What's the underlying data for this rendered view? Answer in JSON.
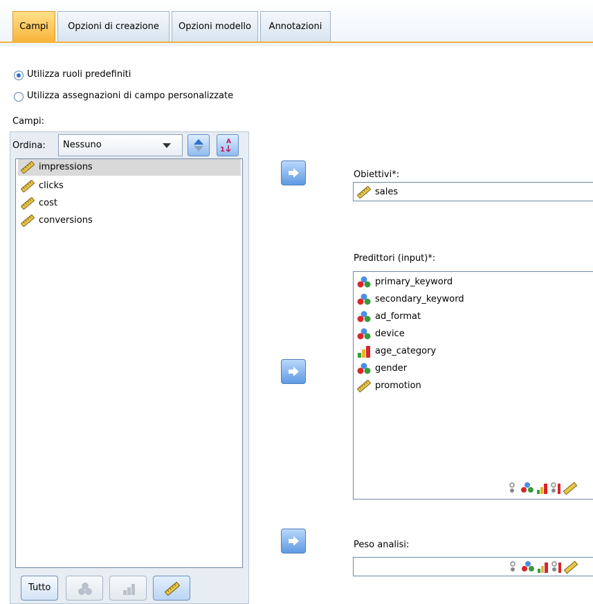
{
  "tabs": [
    {
      "label": "Campi",
      "active": true
    },
    {
      "label": "Opzioni di creazione",
      "active": false
    },
    {
      "label": "Opzioni modello",
      "active": false
    },
    {
      "label": "Annotazioni",
      "active": false
    }
  ],
  "roles": {
    "predefined": {
      "label": "Utilizza ruoli predefiniti",
      "selected": true
    },
    "custom": {
      "label": "Utilizza assegnazioni di campo personalizzate",
      "selected": false
    }
  },
  "fields": {
    "title": "Campi:",
    "sort_label": "Ordina:",
    "sort_value": "Nessuno",
    "items": [
      {
        "label": "impressions",
        "icon": "ruler-icon",
        "selected": true
      },
      {
        "label": "clicks",
        "icon": "ruler-icon",
        "selected": false
      },
      {
        "label": "cost",
        "icon": "ruler-icon",
        "selected": false
      },
      {
        "label": "conversions",
        "icon": "ruler-icon",
        "selected": false
      }
    ],
    "all_button": "Tutto"
  },
  "targets": {
    "label": "Obiettivi*:",
    "items": [
      {
        "label": "sales",
        "icon": "ruler-icon"
      }
    ]
  },
  "predictors": {
    "label": "Predittori (input)*:",
    "items": [
      {
        "label": "primary_keyword",
        "icon": "nominal-icon"
      },
      {
        "label": "secondary_keyword",
        "icon": "nominal-icon"
      },
      {
        "label": "ad_format",
        "icon": "nominal-icon"
      },
      {
        "label": "device",
        "icon": "nominal-icon"
      },
      {
        "label": "age_category",
        "icon": "ordinal-icon"
      },
      {
        "label": "gender",
        "icon": "nominal-icon"
      },
      {
        "label": "promotion",
        "icon": "ruler-icon"
      }
    ]
  },
  "weight": {
    "label": "Peso analisi:"
  },
  "colors": {
    "accent_tab": "#f9b53b",
    "selection": "#d9d9d9",
    "arrow_button": "#5f9ae2"
  }
}
